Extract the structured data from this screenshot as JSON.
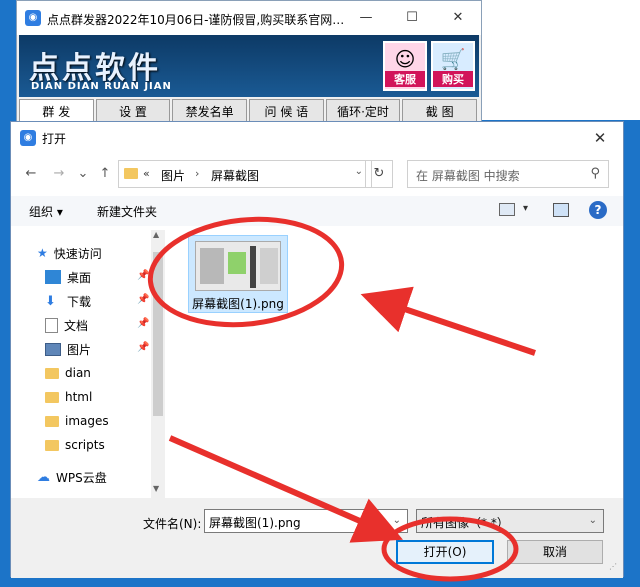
{
  "app": {
    "title": "点点群发器2022年10月06日-谨防假冒,购买联系官网…",
    "icon_glyph": "◉",
    "minimize_glyph": "—",
    "maximize_glyph": "☐",
    "close_glyph": "✕",
    "logo_text": "点点软件",
    "logo_sub": "DIAN DIAN RUAN JIAN",
    "service_label": "客服",
    "service_icon": "headset-icon",
    "service_glyph": "☺",
    "buy_label": "购买",
    "buy_icon": "cart-icon",
    "buy_glyph": "🛒",
    "tabs": [
      "群 发",
      "设 置",
      "禁发名单",
      "问 候 语",
      "循环·定时",
      "截 图"
    ]
  },
  "dialog": {
    "title": "打开",
    "icon_glyph": "◉",
    "close_glyph": "✕",
    "nav": {
      "back": "←",
      "forward": "→",
      "history": "⌄",
      "up": "↑",
      "refresh": "↻"
    },
    "address": {
      "overflow": "«",
      "crumbs": [
        "图片",
        "屏幕截图"
      ],
      "separator": "›",
      "dropdown": "⌄"
    },
    "search_placeholder": "在 屏幕截图 中搜索",
    "search_glyph": "⚲",
    "organize_label": "组织 ▾",
    "new_folder_label": "新建文件夹",
    "view_dropdown": "▾",
    "help_glyph": "?",
    "nav_items": [
      {
        "label": "快速访问",
        "icon": "star-icon",
        "glyph": "★"
      },
      {
        "label": "桌面",
        "icon": "desktop-icon",
        "pinned": "📌"
      },
      {
        "label": "下载",
        "icon": "download-icon",
        "glyph": "⬇",
        "pinned": "📌"
      },
      {
        "label": "文档",
        "icon": "document-icon",
        "pinned": "📌"
      },
      {
        "label": "图片",
        "icon": "pictures-icon",
        "pinned": "📌"
      },
      {
        "label": "dian",
        "icon": "folder-icon"
      },
      {
        "label": "html",
        "icon": "folder-icon"
      },
      {
        "label": "images",
        "icon": "folder-icon"
      },
      {
        "label": "scripts",
        "icon": "folder-icon"
      },
      {
        "label": "WPS云盘",
        "icon": "cloud-icon",
        "glyph": "☁"
      }
    ],
    "scroll_up": "▲",
    "scroll_down": "▼",
    "file": {
      "name": "屏幕截图(1).png"
    },
    "filename_label": "文件名(N):",
    "filename_value": "屏幕截图(1).png",
    "filetype_value": "所有图像（*.*）",
    "open_label": "打开(O)",
    "cancel_label": "取消",
    "grip_glyph": "⋰"
  },
  "colors": {
    "accent": "#0078d7",
    "annotation": "#e8302c"
  }
}
